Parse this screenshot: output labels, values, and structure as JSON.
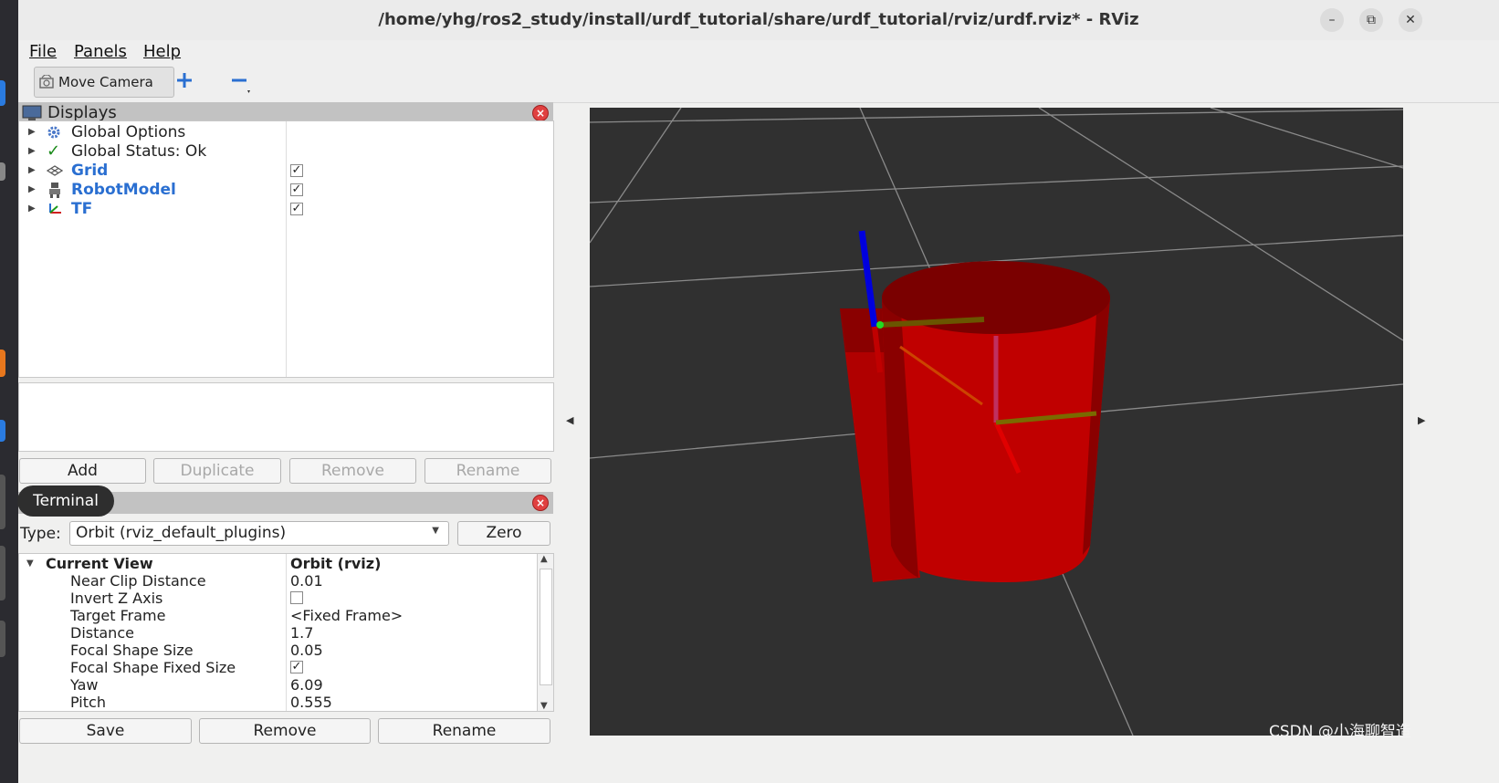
{
  "window": {
    "title": "/home/yhg/ros2_study/install/urdf_tutorial/share/urdf_tutorial/rviz/urdf.rviz* - RViz",
    "minimize": "–",
    "maximize": "⧉",
    "close": "✕"
  },
  "menu": {
    "file": "File",
    "panels": "Panels",
    "help": "Help"
  },
  "toolbar": {
    "move_camera": "Move Camera",
    "add_tool": "+",
    "remove_tool": "−"
  },
  "displays": {
    "title": "Displays",
    "items": [
      {
        "label": "Global Options"
      },
      {
        "label": "Global Status: Ok"
      },
      {
        "label": "Grid",
        "checked": true
      },
      {
        "label": "RobotModel",
        "checked": true
      },
      {
        "label": "TF",
        "checked": true
      }
    ],
    "buttons": {
      "add": "Add",
      "duplicate": "Duplicate",
      "remove": "Remove",
      "rename": "Rename"
    }
  },
  "views": {
    "tab": "Terminal",
    "type_label": "Type:",
    "type_value": "Orbit (rviz_default_plugins)",
    "zero": "Zero",
    "properties": [
      {
        "name": "Current View",
        "value": "Orbit (rviz)"
      },
      {
        "name": "Near Clip Distance",
        "value": "0.01"
      },
      {
        "name": "Invert Z Axis",
        "value": "",
        "checkbox": false
      },
      {
        "name": "Target Frame",
        "value": "<Fixed Frame>"
      },
      {
        "name": "Distance",
        "value": "1.7"
      },
      {
        "name": "Focal Shape Size",
        "value": "0.05"
      },
      {
        "name": "Focal Shape Fixed Size",
        "value": "",
        "checkbox": true
      },
      {
        "name": "Yaw",
        "value": "6.09"
      },
      {
        "name": "Pitch",
        "value": "0.555"
      }
    ],
    "buttons": {
      "save": "Save",
      "remove": "Remove",
      "rename": "Rename"
    }
  },
  "watermark": "CSDN @小海聊智造",
  "colors": {
    "grid_bg": "#303030",
    "robot_red": "#c00000",
    "link_blue": "#2a6fd1"
  }
}
